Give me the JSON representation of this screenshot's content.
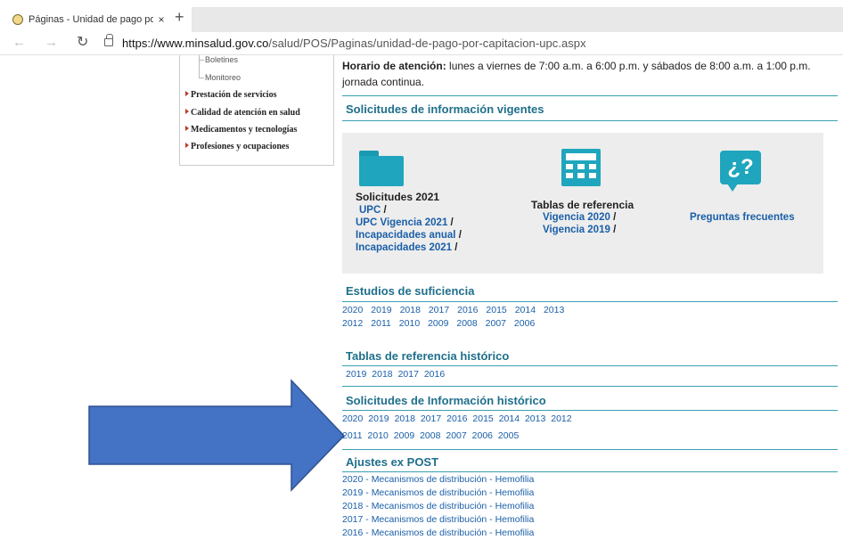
{
  "browser": {
    "tab_title": "Páginas - Unidad de pago por ca",
    "tab_close": "×",
    "new_tab": "+",
    "url_host": "https://www.minsalud.gov.co",
    "url_path": "/salud/POS/Paginas/unidad-de-pago-por-capitacion-upc.aspx"
  },
  "sidebar": {
    "sub_items": [
      "Boletines",
      "Monitoreo"
    ],
    "items": [
      "Prestación de servicios",
      "Calidad de atención en salud",
      "Medicamentos y tecnologías",
      "Profesiones y ocupaciones"
    ]
  },
  "hours": {
    "label": "Horario de atención:",
    "text": " lunes a viernes de 7:00 a.m. a 6:00 p.m. y  sábados de 8:00 a.m. a 1:00 p.m. jornada continua."
  },
  "sections": {
    "vigentes": "Solicitudes de información vigentes",
    "suficiencia": "Estudios de suficiencia",
    "tablas_hist": "Tablas de referencia histórico",
    "solicitudes_hist": "Solicitudes de Información histórico",
    "ajustes": "Ajustes ex POST"
  },
  "box": {
    "col1_title": "Solicitudes 2021",
    "col1_links": [
      "UPC",
      "UPC Vigencia 2021",
      "Incapacidades anual",
      "Incapacidades 2021"
    ],
    "col2_title": "Tablas de referencia",
    "col2_links": [
      "Vigencia 2020",
      "Vigencia 2019"
    ],
    "col3_title": "Preguntas frecuentes",
    "question_icon": "¿?",
    "slash": "/"
  },
  "suficiencia_row1": [
    "2020",
    "2019",
    "2018",
    "2017",
    "2016",
    "2015",
    "2014",
    "2013"
  ],
  "suficiencia_row2": [
    "2012",
    "2011",
    "2010",
    "2009",
    "2008",
    "2007",
    "2006"
  ],
  "tablas_hist_years": [
    "2019",
    "2018",
    "2017",
    "2016"
  ],
  "solicitudes_hist_row1": [
    "2020",
    "2019",
    "2018",
    "2017",
    "2016",
    "2015",
    "2014",
    "2013",
    "2012"
  ],
  "solicitudes_hist_row2": [
    "2011",
    "2010",
    "2009",
    "2008",
    "2007",
    "2006",
    "2005"
  ],
  "hemofilia": [
    "2020 - Mecanismos de distribución - Hemofilia",
    "2019 - Mecanismos de distribución - Hemofilia",
    "2018 - Mecanismos de distribución - Hemofilia",
    "2017 - Mecanismos de distribución - Hemofilia",
    "2016 - Mecanismos de distribución - Hemofilia"
  ],
  "colors": {
    "accent": "#1f6f8b",
    "link": "#1a5fa8",
    "arrow": "#4472c4",
    "icon": "#1fa5bd"
  }
}
